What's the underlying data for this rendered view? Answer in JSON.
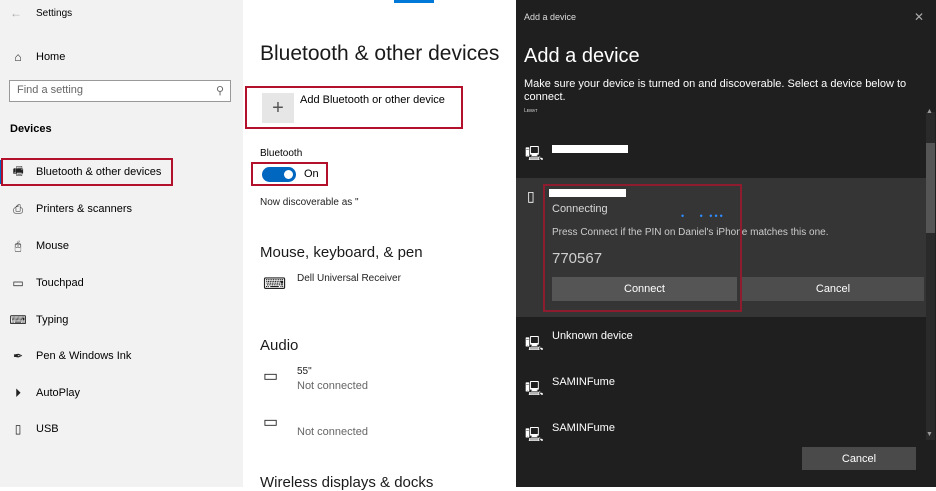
{
  "window": {
    "title": "Settings"
  },
  "sidebar": {
    "home": "Home",
    "search_placeholder": "Find a setting",
    "section": "Devices",
    "items": [
      {
        "label": "Bluetooth & other devices"
      },
      {
        "label": "Printers & scanners"
      },
      {
        "label": "Mouse"
      },
      {
        "label": "Touchpad"
      },
      {
        "label": "Typing"
      },
      {
        "label": "Pen & Windows Ink"
      },
      {
        "label": "AutoPlay"
      },
      {
        "label": "USB"
      }
    ]
  },
  "main": {
    "title": "Bluetooth & other devices",
    "add_device": "Add Bluetooth or other device",
    "bluetooth_label": "Bluetooth",
    "toggle_state": "On",
    "discoverable": "Now discoverable as \"",
    "mouse_section": "Mouse, keyboard, & pen",
    "mouse_device": "Dell Universal Receiver",
    "audio_section": "Audio",
    "audio_devices": [
      {
        "name": "55\"",
        "status": "Not connected"
      },
      {
        "name": "",
        "status": "Not connected"
      }
    ],
    "wireless_section": "Wireless displays & docks"
  },
  "dialog": {
    "title_bar": "Add a device",
    "heading": "Add a device",
    "description": "Make sure your device is turned on and discoverable. Select a device below to connect.",
    "small_label": "Lᴇᴍᴀᴛ",
    "selected": {
      "status": "Connecting",
      "instruction": "Press Connect if the PIN on Daniel's iPhone matches this one.",
      "pin": "770567",
      "connect": "Connect",
      "cancel": "Cancel"
    },
    "devices": [
      {
        "name": "Unknown device"
      },
      {
        "name": "SAMINFume"
      },
      {
        "name": "SAMINFume"
      }
    ],
    "cancel": "Cancel"
  }
}
